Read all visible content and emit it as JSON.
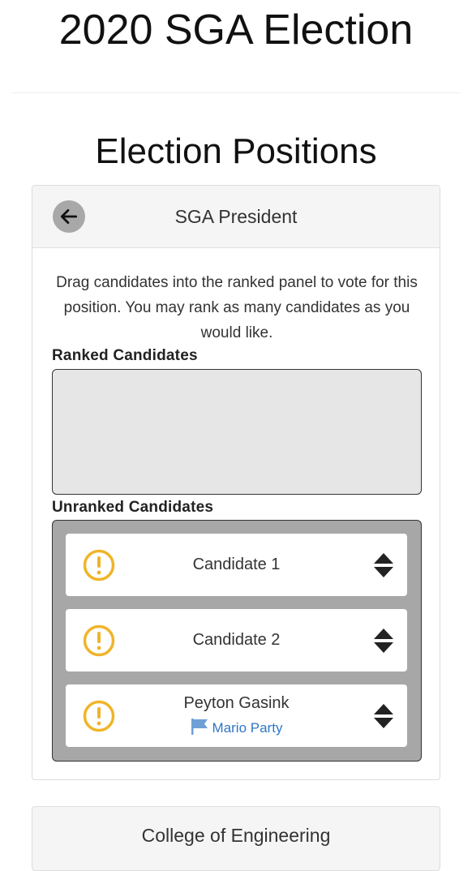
{
  "app": {
    "title": "2020 SGA Election"
  },
  "page": {
    "section_title": "Election Positions"
  },
  "position_card": {
    "title": "SGA President",
    "instructions": "Drag candidates into the ranked panel to vote for this position. You may rank as many candidates as you would like.",
    "ranked_label": "Ranked Candidates",
    "unranked_label": "Unranked Candidates",
    "unranked_candidates": [
      {
        "name": "Candidate 1",
        "party": ""
      },
      {
        "name": "Candidate 2",
        "party": ""
      },
      {
        "name": "Peyton Gasink",
        "party": "Mario Party"
      }
    ]
  },
  "next_card": {
    "title": "College of Engineering"
  },
  "icons": {
    "back": "arrow-left-icon",
    "status": "exclamation-circle-icon",
    "sort": "sort-icon",
    "party": "flag-icon"
  },
  "colors": {
    "warning": "#f0b429",
    "party_link": "#2f77c5",
    "unranked_bg": "#a7a7a7",
    "ranked_bg": "#e6e6e6"
  }
}
